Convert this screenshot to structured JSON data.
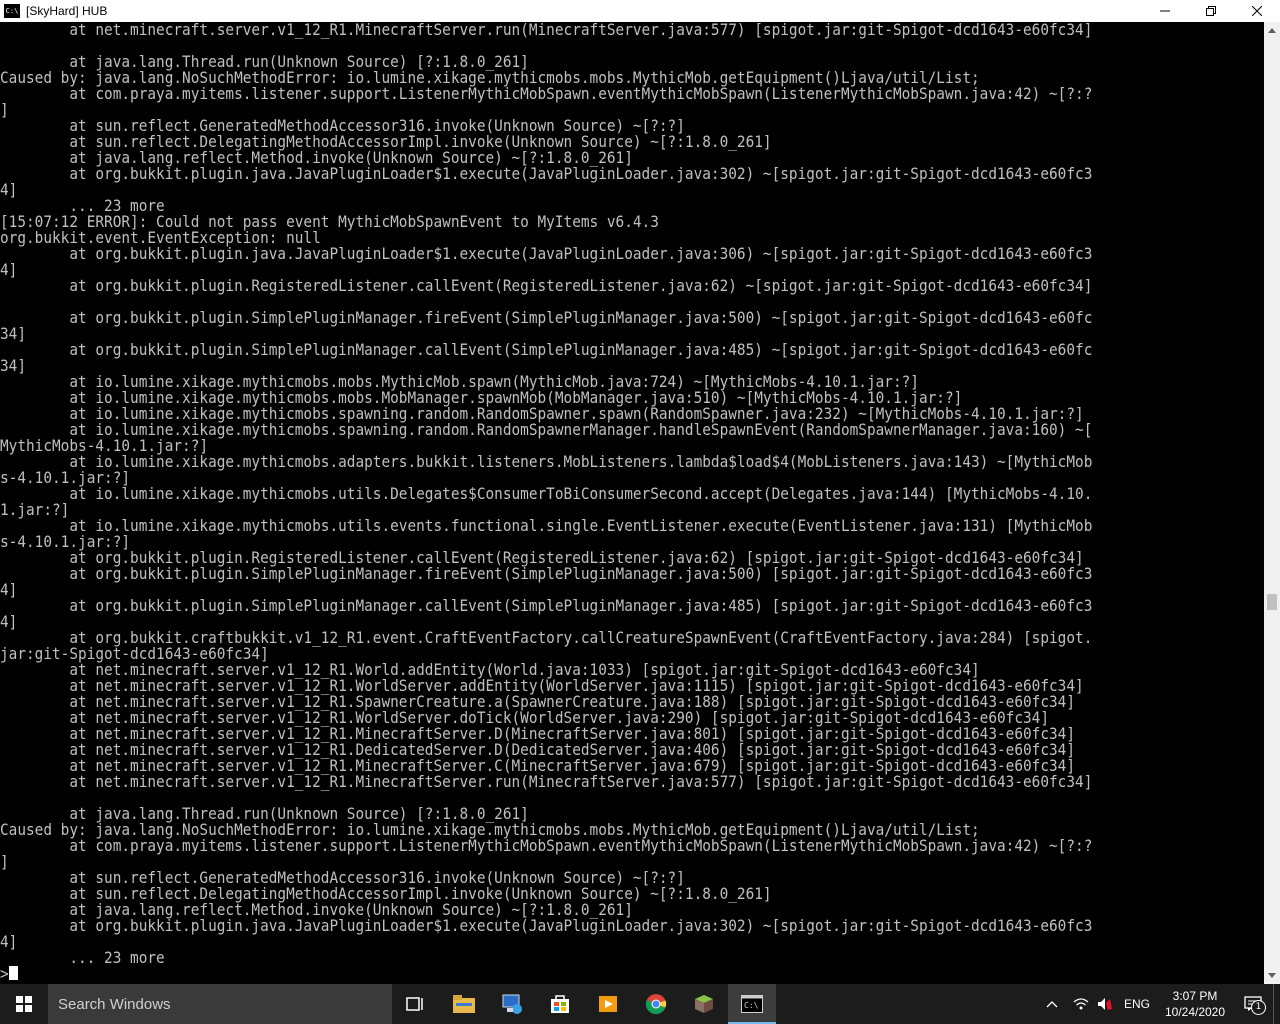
{
  "window": {
    "title": "[SkyHard] HUB",
    "app_icon_text": "C:\\"
  },
  "console": {
    "lines": [
      "        at net.minecraft.server.v1_12_R1.MinecraftServer.run(MinecraftServer.java:577) [spigot.jar:git-Spigot-dcd1643-e60fc34]",
      "",
      "        at java.lang.Thread.run(Unknown Source) [?:1.8.0_261]",
      "Caused by: java.lang.NoSuchMethodError: io.lumine.xikage.mythicmobs.mobs.MythicMob.getEquipment()Ljava/util/List;",
      "        at com.praya.myitems.listener.support.ListenerMythicMobSpawn.eventMythicMobSpawn(ListenerMythicMobSpawn.java:42) ~[?:?",
      "]",
      "        at sun.reflect.GeneratedMethodAccessor316.invoke(Unknown Source) ~[?:?]",
      "        at sun.reflect.DelegatingMethodAccessorImpl.invoke(Unknown Source) ~[?:1.8.0_261]",
      "        at java.lang.reflect.Method.invoke(Unknown Source) ~[?:1.8.0_261]",
      "        at org.bukkit.plugin.java.JavaPluginLoader$1.execute(JavaPluginLoader.java:302) ~[spigot.jar:git-Spigot-dcd1643-e60fc3",
      "4]",
      "        ... 23 more",
      "[15:07:12 ERROR]: Could not pass event MythicMobSpawnEvent to MyItems v6.4.3",
      "org.bukkit.event.EventException: null",
      "        at org.bukkit.plugin.java.JavaPluginLoader$1.execute(JavaPluginLoader.java:306) ~[spigot.jar:git-Spigot-dcd1643-e60fc3",
      "4]",
      "        at org.bukkit.plugin.RegisteredListener.callEvent(RegisteredListener.java:62) ~[spigot.jar:git-Spigot-dcd1643-e60fc34]",
      "",
      "        at org.bukkit.plugin.SimplePluginManager.fireEvent(SimplePluginManager.java:500) ~[spigot.jar:git-Spigot-dcd1643-e60fc",
      "34]",
      "        at org.bukkit.plugin.SimplePluginManager.callEvent(SimplePluginManager.java:485) ~[spigot.jar:git-Spigot-dcd1643-e60fc",
      "34]",
      "        at io.lumine.xikage.mythicmobs.mobs.MythicMob.spawn(MythicMob.java:724) ~[MythicMobs-4.10.1.jar:?]",
      "        at io.lumine.xikage.mythicmobs.mobs.MobManager.spawnMob(MobManager.java:510) ~[MythicMobs-4.10.1.jar:?]",
      "        at io.lumine.xikage.mythicmobs.spawning.random.RandomSpawner.spawn(RandomSpawner.java:232) ~[MythicMobs-4.10.1.jar:?]",
      "        at io.lumine.xikage.mythicmobs.spawning.random.RandomSpawnerManager.handleSpawnEvent(RandomSpawnerManager.java:160) ~[",
      "MythicMobs-4.10.1.jar:?]",
      "        at io.lumine.xikage.mythicmobs.adapters.bukkit.listeners.MobListeners.lambda$load$4(MobListeners.java:143) ~[MythicMob",
      "s-4.10.1.jar:?]",
      "        at io.lumine.xikage.mythicmobs.utils.Delegates$ConsumerToBiConsumerSecond.accept(Delegates.java:144) [MythicMobs-4.10.",
      "1.jar:?]",
      "        at io.lumine.xikage.mythicmobs.utils.events.functional.single.EventListener.execute(EventListener.java:131) [MythicMob",
      "s-4.10.1.jar:?]",
      "        at org.bukkit.plugin.RegisteredListener.callEvent(RegisteredListener.java:62) [spigot.jar:git-Spigot-dcd1643-e60fc34]",
      "        at org.bukkit.plugin.SimplePluginManager.fireEvent(SimplePluginManager.java:500) [spigot.jar:git-Spigot-dcd1643-e60fc3",
      "4]",
      "        at org.bukkit.plugin.SimplePluginManager.callEvent(SimplePluginManager.java:485) [spigot.jar:git-Spigot-dcd1643-e60fc3",
      "4]",
      "        at org.bukkit.craftbukkit.v1_12_R1.event.CraftEventFactory.callCreatureSpawnEvent(CraftEventFactory.java:284) [spigot.",
      "jar:git-Spigot-dcd1643-e60fc34]",
      "        at net.minecraft.server.v1_12_R1.World.addEntity(World.java:1033) [spigot.jar:git-Spigot-dcd1643-e60fc34]",
      "        at net.minecraft.server.v1_12_R1.WorldServer.addEntity(WorldServer.java:1115) [spigot.jar:git-Spigot-dcd1643-e60fc34]",
      "        at net.minecraft.server.v1_12_R1.SpawnerCreature.a(SpawnerCreature.java:188) [spigot.jar:git-Spigot-dcd1643-e60fc34]",
      "        at net.minecraft.server.v1_12_R1.WorldServer.doTick(WorldServer.java:290) [spigot.jar:git-Spigot-dcd1643-e60fc34]",
      "        at net.minecraft.server.v1_12_R1.MinecraftServer.D(MinecraftServer.java:801) [spigot.jar:git-Spigot-dcd1643-e60fc34]",
      "        at net.minecraft.server.v1_12_R1.DedicatedServer.D(DedicatedServer.java:406) [spigot.jar:git-Spigot-dcd1643-e60fc34]",
      "        at net.minecraft.server.v1_12_R1.MinecraftServer.C(MinecraftServer.java:679) [spigot.jar:git-Spigot-dcd1643-e60fc34]",
      "        at net.minecraft.server.v1_12_R1.MinecraftServer.run(MinecraftServer.java:577) [spigot.jar:git-Spigot-dcd1643-e60fc34]",
      "",
      "        at java.lang.Thread.run(Unknown Source) [?:1.8.0_261]",
      "Caused by: java.lang.NoSuchMethodError: io.lumine.xikage.mythicmobs.mobs.MythicMob.getEquipment()Ljava/util/List;",
      "        at com.praya.myitems.listener.support.ListenerMythicMobSpawn.eventMythicMobSpawn(ListenerMythicMobSpawn.java:42) ~[?:?",
      "]",
      "        at sun.reflect.GeneratedMethodAccessor316.invoke(Unknown Source) ~[?:?]",
      "        at sun.reflect.DelegatingMethodAccessorImpl.invoke(Unknown Source) ~[?:1.8.0_261]",
      "        at java.lang.reflect.Method.invoke(Unknown Source) ~[?:1.8.0_261]",
      "        at org.bukkit.plugin.java.JavaPluginLoader$1.execute(JavaPluginLoader.java:302) ~[spigot.jar:git-Spigot-dcd1643-e60fc3",
      "4]",
      "        ... 23 more"
    ],
    "prompt": ">"
  },
  "taskbar": {
    "search_placeholder": "Search Windows",
    "apps": [
      {
        "name": "task-view-icon"
      },
      {
        "name": "file-explorer-icon"
      },
      {
        "name": "network-app-icon"
      },
      {
        "name": "store-icon"
      },
      {
        "name": "media-player-icon"
      },
      {
        "name": "chrome-icon"
      },
      {
        "name": "minecraft-icon"
      },
      {
        "name": "console-icon",
        "active": true
      }
    ],
    "tray": {
      "language": "ENG",
      "time": "3:07 PM",
      "date": "10/24/2020",
      "notification_count": "1"
    }
  },
  "colors": {
    "console_bg": "#000000",
    "console_text": "#c0c0c0",
    "taskbar_bg": "#1c1c1c",
    "accent": "#76b9ed"
  }
}
